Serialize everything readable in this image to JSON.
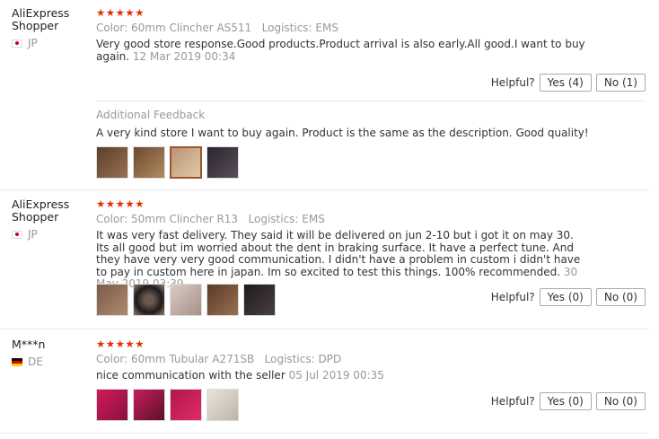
{
  "reviews": [
    {
      "user": "AliExpress Shopper",
      "country": "JP",
      "stars": "★★★★★",
      "color_label": "Color:",
      "color_value": "60mm Clincher AS511",
      "logistics_label": "Logistics:",
      "logistics_value": "EMS",
      "text": "Very good store response.Good products.Product arrival is also early.All good.I want to buy again.",
      "date": "12 Mar 2019 00:34",
      "helpful_label": "Helpful?",
      "yes": "Yes (4)",
      "no": "No (1)",
      "additional_title": "Additional Feedback",
      "additional_text": "A very kind store I want to buy again. Product is the same as the description. Good quality!",
      "thumb_colors": [
        "#7a5a3e",
        "#9c6f47",
        "#c9a582",
        "#3b3540"
      ]
    },
    {
      "user": "AliExpress Shopper",
      "country": "JP",
      "stars": "★★★★★",
      "color_label": "Color:",
      "color_value": "50mm Clincher R13",
      "logistics_label": "Logistics:",
      "logistics_value": "EMS",
      "text": "It was very fast delivery. They said it will be delivered on jun 2-10 but i got it on may 30. Its all good but im worried about the dent in braking surface. It have a perfect tune. And they have very very good communication. I didn't have a problem in custom i didn't have to pay in custom here in japan. Im so excited to test this things. 100% recommended.",
      "date": "30 May 2019 03:39",
      "helpful_label": "Helpful?",
      "yes": "Yes (0)",
      "no": "No (0)",
      "thumb_colors": [
        "#8a6a55",
        "#3a3230",
        "#b8a8a0",
        "#6b4a38",
        "#2e2a2a"
      ]
    },
    {
      "user": "M***n",
      "country": "DE",
      "stars": "★★★★★",
      "color_label": "Color:",
      "color_value": "60mm Tubular A271SB",
      "logistics_label": "Logistics:",
      "logistics_value": "DPD",
      "text": "nice communication with the seller",
      "date": "05 Jul 2019 00:35",
      "helpful_label": "Helpful?",
      "yes": "Yes (0)",
      "no": "No (0)",
      "thumb_colors": [
        "#c2185b",
        "#b0205a",
        "#a8184a",
        "#d8d4cc"
      ]
    }
  ]
}
